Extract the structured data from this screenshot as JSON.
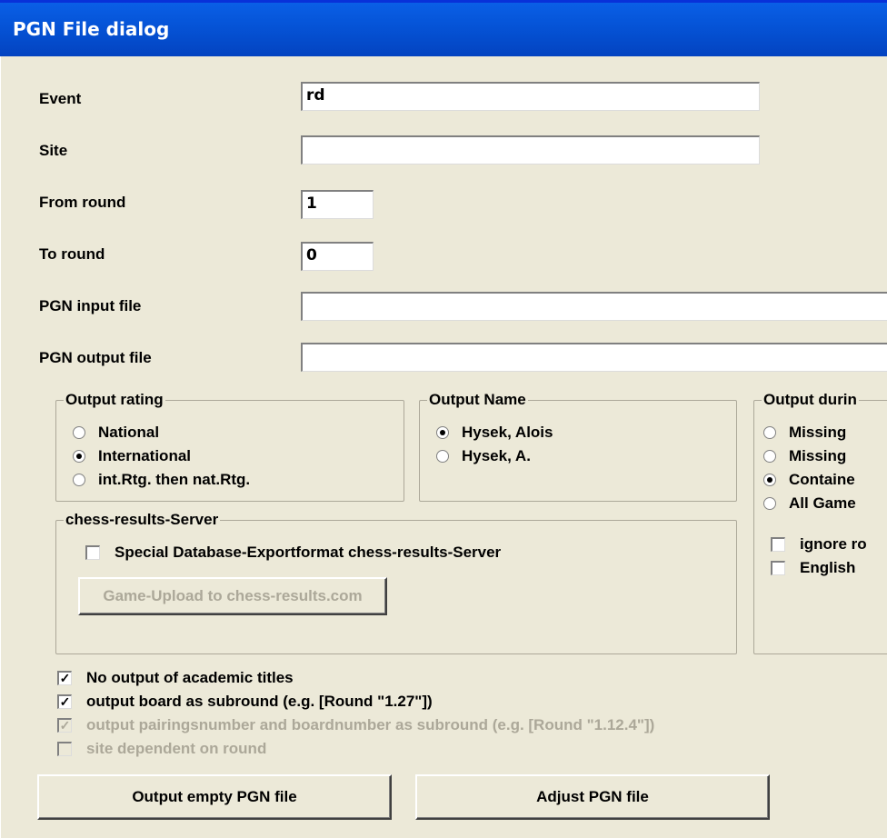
{
  "window": {
    "title": "PGN File dialog"
  },
  "fields": {
    "event": {
      "label": "Event",
      "value": "rd"
    },
    "site": {
      "label": "Site",
      "value": ""
    },
    "from_round": {
      "label": "From round",
      "value": "1"
    },
    "to_round": {
      "label": "To round",
      "value": "0"
    },
    "pgn_input": {
      "label": "PGN input file",
      "value": ""
    },
    "pgn_output": {
      "label": "PGN output file",
      "value": ""
    }
  },
  "output_rating": {
    "title": "Output rating",
    "options": [
      "National",
      "International",
      "int.Rtg. then nat.Rtg."
    ],
    "selected_index": 1
  },
  "output_name": {
    "title": "Output Name",
    "options": [
      "Hysek, Alois",
      "Hysek, A."
    ],
    "selected_index": 0
  },
  "output_during": {
    "title": "Output durin",
    "options": [
      "Missing",
      "Missing",
      "Containe",
      "All Game"
    ],
    "selected_index": 2,
    "checks": [
      "ignore ro",
      "English"
    ]
  },
  "chess_results": {
    "title": "chess-results-Server",
    "special_label": "Special Database-Exportformat chess-results-Server",
    "special_checked": false,
    "upload_button": "Game-Upload to chess-results.com"
  },
  "options": [
    {
      "label": "No output of academic titles",
      "checked": true,
      "enabled": true
    },
    {
      "label": "output board as subround (e.g. [Round \"1.27\"])",
      "checked": true,
      "enabled": true
    },
    {
      "label": "output pairingsnumber and boardnumber as subround (e.g. [Round \"1.12.4\"])",
      "checked": true,
      "enabled": false
    },
    {
      "label": "site dependent on round",
      "checked": false,
      "enabled": false
    }
  ],
  "buttons": {
    "empty_pgn": "Output empty PGN file",
    "adjust_pgn": "Adjust PGN file"
  }
}
